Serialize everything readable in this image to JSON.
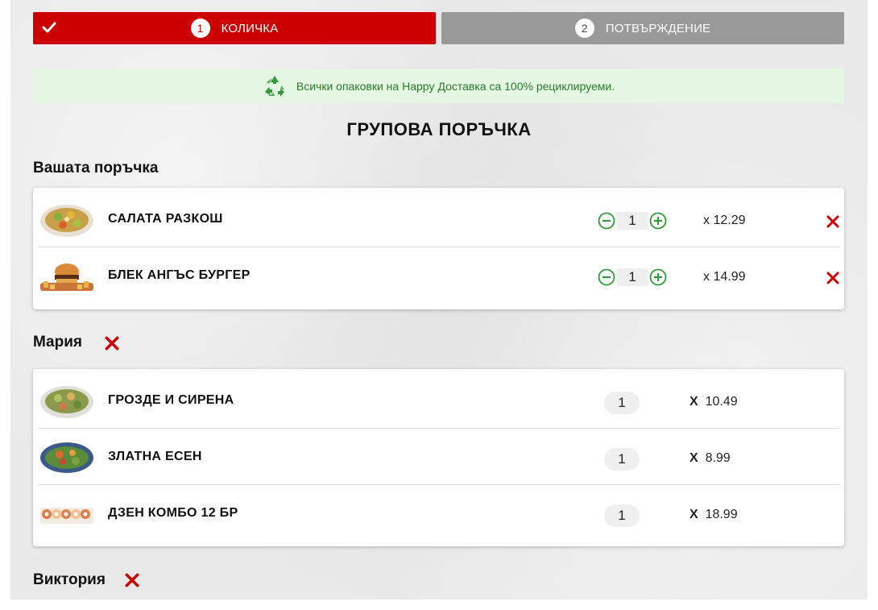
{
  "steps": [
    {
      "number": "1",
      "label": "КОЛИЧКА",
      "state": "active"
    },
    {
      "number": "2",
      "label": "ПОТВЪРЖДЕНИЕ",
      "state": "inactive"
    }
  ],
  "eco_banner": {
    "text": "Всички опаковки на Happy Доставка са 100% рециклируеми.",
    "icon": "recycle-icon"
  },
  "page_title": "ГРУПОВА ПОРЪЧКА",
  "your_order": {
    "label": "Вашата поръчка",
    "items": [
      {
        "name": "САЛАТА РАЗКОШ",
        "qty": "1",
        "price": "x  12.29"
      },
      {
        "name": "БЛЕК АНГЪС БУРГЕР",
        "qty": "1",
        "price": "x  14.99"
      }
    ]
  },
  "participants": [
    {
      "name": "Мария",
      "items": [
        {
          "name": "ГРОЗДЕ И СИРЕНА",
          "qty": "1",
          "price_prefix": "X",
          "price": "10.49"
        },
        {
          "name": "ЗЛАТНА ЕСЕН",
          "qty": "1",
          "price_prefix": "X",
          "price": "8.99"
        },
        {
          "name": "ДЗЕН КОМБО 12 БР",
          "qty": "1",
          "price_prefix": "X",
          "price": "18.99"
        }
      ]
    },
    {
      "name": "Виктория",
      "items": []
    }
  ],
  "colors": {
    "brand_red": "#cc0000",
    "inactive_gray": "#999999",
    "eco_green": "#2b7a2b",
    "eco_bg": "#e3f7e3"
  }
}
